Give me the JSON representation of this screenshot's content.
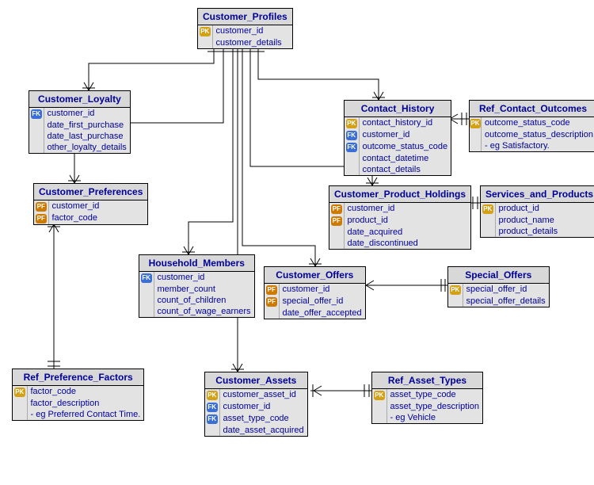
{
  "entities": {
    "customer_profiles": {
      "title": "Customer_Profiles",
      "cols": [
        {
          "k": "PK",
          "name": "customer_id"
        },
        {
          "k": "",
          "name": "customer_details"
        }
      ]
    },
    "customer_loyalty": {
      "title": "Customer_Loyalty",
      "cols": [
        {
          "k": "FK",
          "name": "customer_id"
        },
        {
          "k": "",
          "name": "date_first_purchase"
        },
        {
          "k": "",
          "name": "date_last_purchase"
        },
        {
          "k": "",
          "name": "other_loyalty_details"
        }
      ]
    },
    "contact_history": {
      "title": "Contact_History",
      "cols": [
        {
          "k": "PK",
          "name": "contact_history_id"
        },
        {
          "k": "FK",
          "name": "customer_id"
        },
        {
          "k": "FK",
          "name": "outcome_status_code"
        },
        {
          "k": "",
          "name": "contact_datetime"
        },
        {
          "k": "",
          "name": "contact_details"
        }
      ]
    },
    "ref_contact_outcomes": {
      "title": "Ref_Contact_Outcomes",
      "cols": [
        {
          "k": "PK",
          "name": "outcome_status_code"
        },
        {
          "k": "",
          "name": "outcome_status_description"
        },
        {
          "k": "",
          "name": "- eg Satisfactory."
        }
      ]
    },
    "customer_preferences": {
      "title": "Customer_Preferences",
      "cols": [
        {
          "k": "PF",
          "name": "customer_id"
        },
        {
          "k": "PF",
          "name": "factor_code"
        }
      ]
    },
    "customer_product_holdings": {
      "title": "Customer_Product_Holdings",
      "cols": [
        {
          "k": "PF",
          "name": "customer_id"
        },
        {
          "k": "PF",
          "name": "product_id"
        },
        {
          "k": "",
          "name": "date_acquired"
        },
        {
          "k": "",
          "name": "date_discontinued"
        }
      ]
    },
    "services_and_products": {
      "title": "Services_and_Products",
      "cols": [
        {
          "k": "PK",
          "name": "product_id"
        },
        {
          "k": "",
          "name": "product_name"
        },
        {
          "k": "",
          "name": "product_details"
        }
      ]
    },
    "household_members": {
      "title": "Household_Members",
      "cols": [
        {
          "k": "FK",
          "name": "customer_id"
        },
        {
          "k": "",
          "name": "member_count"
        },
        {
          "k": "",
          "name": "count_of_children"
        },
        {
          "k": "",
          "name": "count_of_wage_earners"
        }
      ]
    },
    "customer_offers": {
      "title": "Customer_Offers",
      "cols": [
        {
          "k": "PF",
          "name": "customer_id"
        },
        {
          "k": "PF",
          "name": "special_offer_id"
        },
        {
          "k": "",
          "name": "date_offer_accepted"
        }
      ]
    },
    "special_offers": {
      "title": "Special_Offers",
      "cols": [
        {
          "k": "PK",
          "name": "special_offer_id"
        },
        {
          "k": "",
          "name": "special_offer_details"
        }
      ]
    },
    "ref_preference_factors": {
      "title": "Ref_Preference_Factors",
      "cols": [
        {
          "k": "PK",
          "name": "factor_code"
        },
        {
          "k": "",
          "name": "factor_description"
        },
        {
          "k": "",
          "name": "- eg Preferred Contact Time."
        }
      ]
    },
    "customer_assets": {
      "title": "Customer_Assets",
      "cols": [
        {
          "k": "PK",
          "name": "customer_asset_id"
        },
        {
          "k": "FK",
          "name": "customer_id"
        },
        {
          "k": "FK",
          "name": "asset_type_code"
        },
        {
          "k": "",
          "name": "date_asset_acquired"
        }
      ]
    },
    "ref_asset_types": {
      "title": "Ref_Asset_Types",
      "cols": [
        {
          "k": "PK",
          "name": "asset_type_code"
        },
        {
          "k": "",
          "name": "asset_type_description"
        },
        {
          "k": "",
          "name": "- eg Vehicle"
        }
      ]
    }
  }
}
